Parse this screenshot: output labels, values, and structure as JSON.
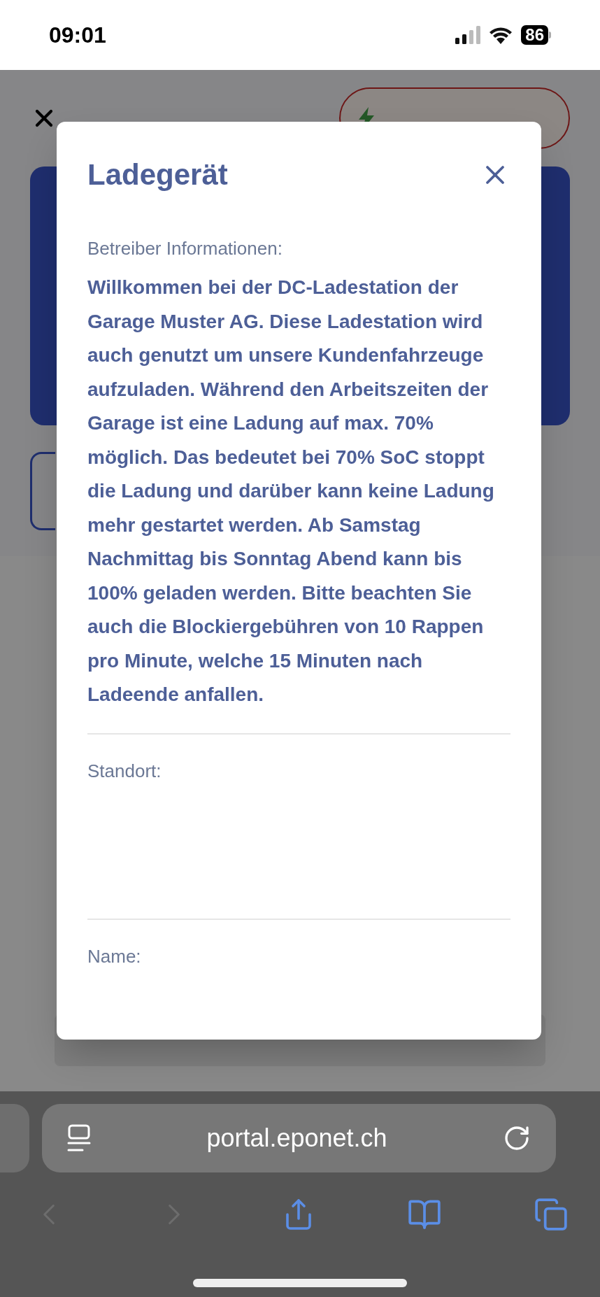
{
  "status_bar": {
    "time": "09:01",
    "battery": "86"
  },
  "dialog": {
    "title": "Ladegerät",
    "sections": [
      {
        "label": "Betreiber Informationen:",
        "text": "Willkommen bei der DC-Ladestation der Garage Muster AG. Diese Ladestation wird auch genutzt um unsere Kundenfahrzeuge aufzuladen. Während den Arbeitszeiten der Garage ist eine Ladung auf max. 70% möglich. Das bedeutet bei 70% SoC stoppt die Ladung und darüber kann keine Ladung mehr gestartet werden. Ab Samstag Nachmittag bis Sonntag Abend kann bis 100% geladen werden. Bitte beachten Sie auch die Blockiergebühren von 10 Rappen pro Minute, welche 15 Minuten nach Ladeende anfallen."
      },
      {
        "label": "Standort:"
      },
      {
        "label": "Name:"
      }
    ]
  },
  "browser": {
    "url": "portal.eponet.ch"
  }
}
